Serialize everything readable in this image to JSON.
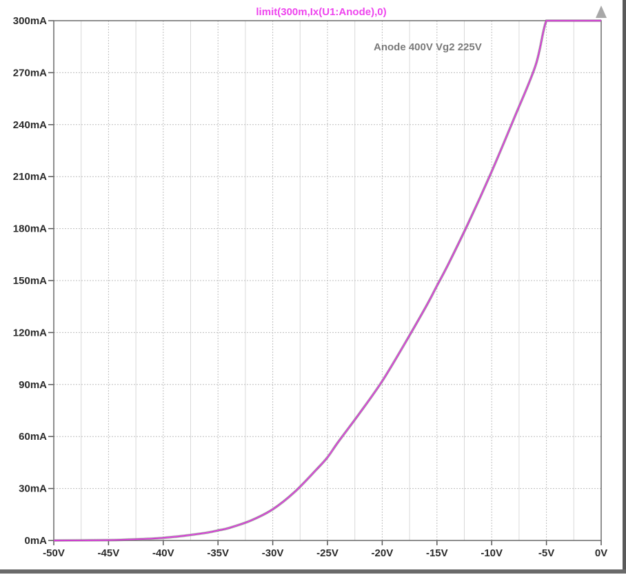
{
  "chart_data": {
    "type": "line",
    "title": "limit(300m,Ix(U1:Anode),0)",
    "annotation": "Anode 400V  Vg2 225V",
    "xlabel": "",
    "ylabel": "",
    "xlim": [
      -50,
      0
    ],
    "ylim": [
      0,
      300
    ],
    "grid": true,
    "x_ticks": [
      -50,
      -45,
      -40,
      -35,
      -30,
      -25,
      -20,
      -15,
      -10,
      -5,
      0
    ],
    "x_tick_labels": [
      "-50V",
      "-45V",
      "-40V",
      "-35V",
      "-30V",
      "-25V",
      "-20V",
      "-15V",
      "-10V",
      "-5V",
      "0V"
    ],
    "y_ticks": [
      0,
      30,
      60,
      90,
      120,
      150,
      180,
      210,
      240,
      270,
      300
    ],
    "y_tick_labels": [
      "0mA",
      "30mA",
      "60mA",
      "90mA",
      "120mA",
      "150mA",
      "180mA",
      "210mA",
      "240mA",
      "270mA",
      "300mA"
    ],
    "series": [
      {
        "color": "#ee44ee",
        "x": [
          -50,
          -45,
          -42,
          -40,
          -38,
          -36,
          -35,
          -34,
          -32,
          -30,
          -28,
          -26,
          -25,
          -24,
          -22,
          -20,
          -18,
          -16,
          -15,
          -14,
          -12,
          -10,
          -8,
          -6,
          -5,
          -4,
          -2,
          0
        ],
        "y": [
          0,
          0.2,
          0.8,
          1.5,
          2.8,
          4.5,
          5.8,
          7.2,
          11.5,
          18,
          28,
          41,
          48,
          57,
          74,
          92,
          113,
          135,
          147,
          159,
          185,
          213,
          243,
          274,
          300,
          300,
          300,
          300
        ]
      }
    ]
  }
}
